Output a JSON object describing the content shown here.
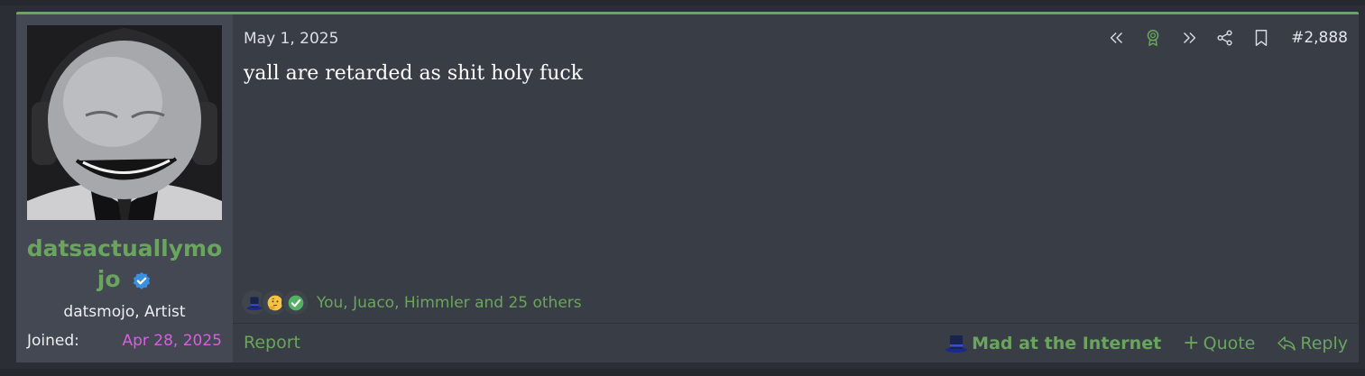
{
  "post": {
    "date": "May 1, 2025",
    "number": "#2,888",
    "body": "yall are retarded as shit holy fuck",
    "reactions_text": "You, Juaco, Himmler and 25 others"
  },
  "user": {
    "name": "datsactuallymojo",
    "name_line1": "datsactuallymo",
    "name_line2": "jo",
    "title": "datsmojo, Artist",
    "joined_label": "Joined:",
    "joined_date": "Apr 28, 2025"
  },
  "footer": {
    "report": "Report",
    "mad": "Mad at the Internet",
    "quote": "Quote",
    "reply": "Reply"
  },
  "icons": {
    "actions": [
      "rewind-icon",
      "award-icon",
      "fast-forward-icon",
      "share-icon",
      "bookmark-icon"
    ],
    "reactions": [
      "top-hat-icon",
      "thinking-face-icon",
      "check-mark-icon"
    ]
  },
  "colors": {
    "accent": "#6aa55d",
    "joined": "#d95fe0",
    "verified": "#3b8fe0"
  }
}
